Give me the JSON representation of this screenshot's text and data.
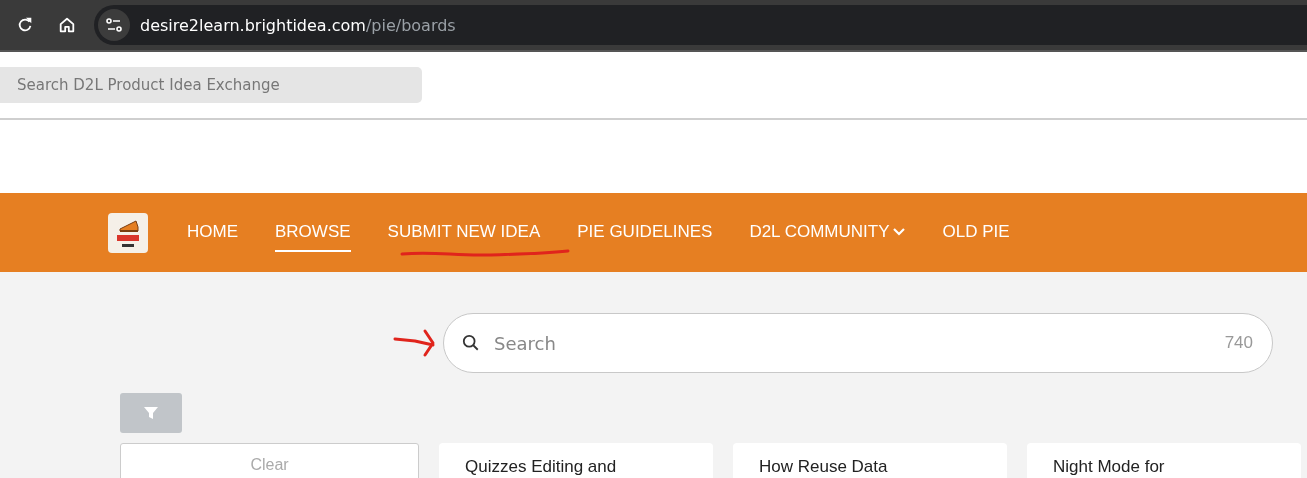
{
  "browser": {
    "url_host": "desire2learn.brightidea.com",
    "url_path": "/pie/boards"
  },
  "site_search": {
    "placeholder": "Search D2L Product Idea Exchange"
  },
  "nav": {
    "items": [
      {
        "label": "HOME",
        "selected": false,
        "has_menu": false
      },
      {
        "label": "BROWSE",
        "selected": true,
        "has_menu": false
      },
      {
        "label": "SUBMIT NEW IDEA",
        "selected": false,
        "has_menu": false
      },
      {
        "label": "PIE GUIDELINES",
        "selected": false,
        "has_menu": false
      },
      {
        "label": "D2L COMMUNITY",
        "selected": false,
        "has_menu": true
      },
      {
        "label": "OLD PIE",
        "selected": false,
        "has_menu": false
      }
    ]
  },
  "idea_search": {
    "placeholder": "Search",
    "count": "740"
  },
  "filter_panel": {
    "clear_label": "Clear"
  },
  "ideas": [
    {
      "title": "Quizzes Editing and"
    },
    {
      "title": "How Reuse Data"
    },
    {
      "title": "Night Mode for"
    }
  ]
}
